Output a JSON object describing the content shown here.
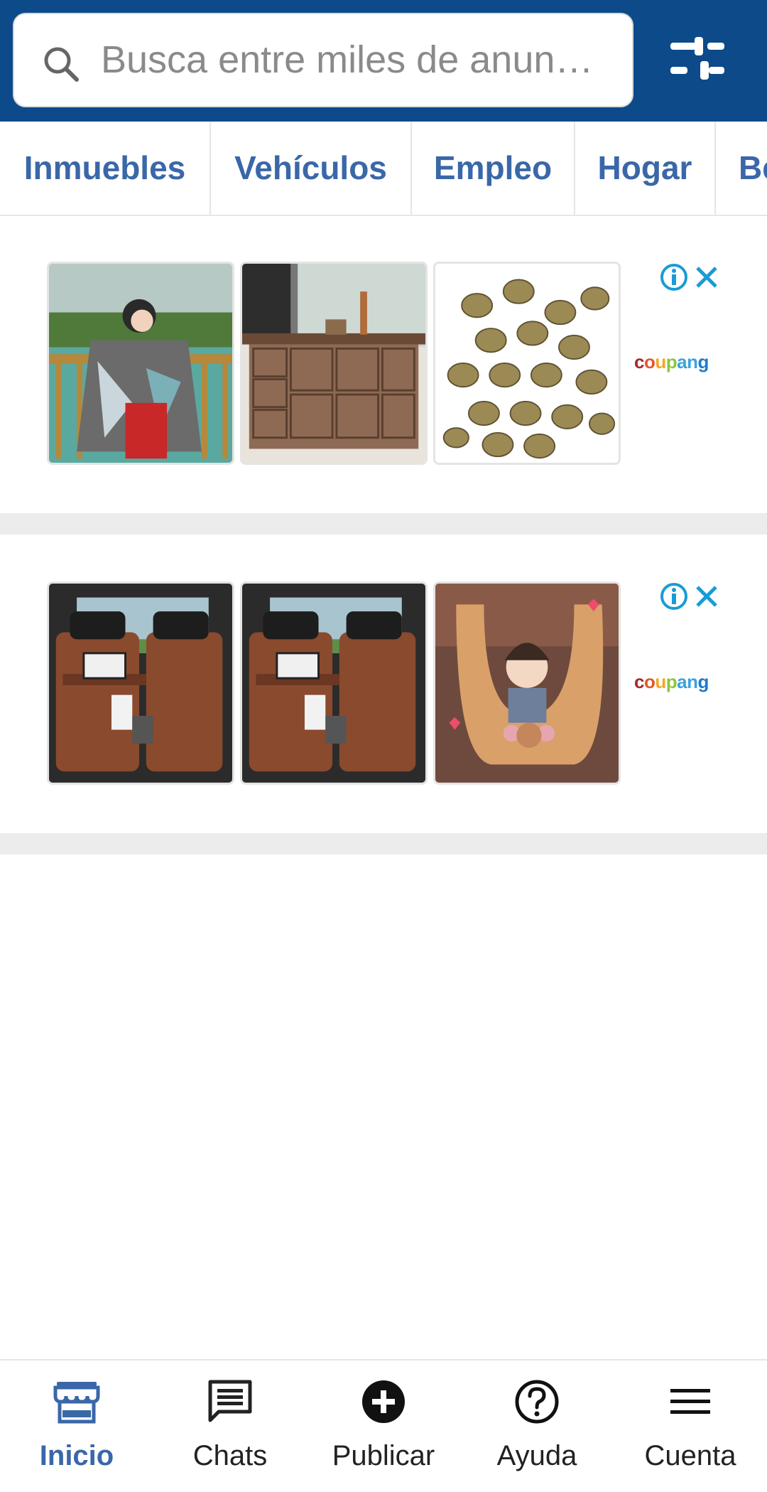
{
  "search": {
    "placeholder": "Busca entre miles de anun…"
  },
  "categories": [
    "Inmuebles",
    "Vehículos",
    "Empleo",
    "Hogar",
    "Be"
  ],
  "ads": [
    {
      "brand": [
        "c",
        "o",
        "u",
        "p",
        "a",
        "n",
        "g"
      ],
      "products": [
        "woman-shawl-photo",
        "dresser-photo",
        "metal-charms-photo"
      ]
    },
    {
      "brand": [
        "c",
        "o",
        "u",
        "p",
        "a",
        "n",
        "g"
      ],
      "products": [
        "car-seat-organizer-photo",
        "car-seat-organizer-photo",
        "child-pillow-photo"
      ]
    }
  ],
  "nav": [
    {
      "label": "Inicio",
      "icon": "store-icon",
      "active": true
    },
    {
      "label": "Chats",
      "icon": "chat-icon",
      "active": false
    },
    {
      "label": "Publicar",
      "icon": "add-circle-icon",
      "active": false
    },
    {
      "label": "Ayuda",
      "icon": "help-icon",
      "active": false
    },
    {
      "label": "Cuenta",
      "icon": "menu-icon",
      "active": false
    }
  ],
  "colors": {
    "header": "#0d4a8a",
    "accent": "#3a67a8",
    "ad_badge": "#1a9bd6"
  }
}
